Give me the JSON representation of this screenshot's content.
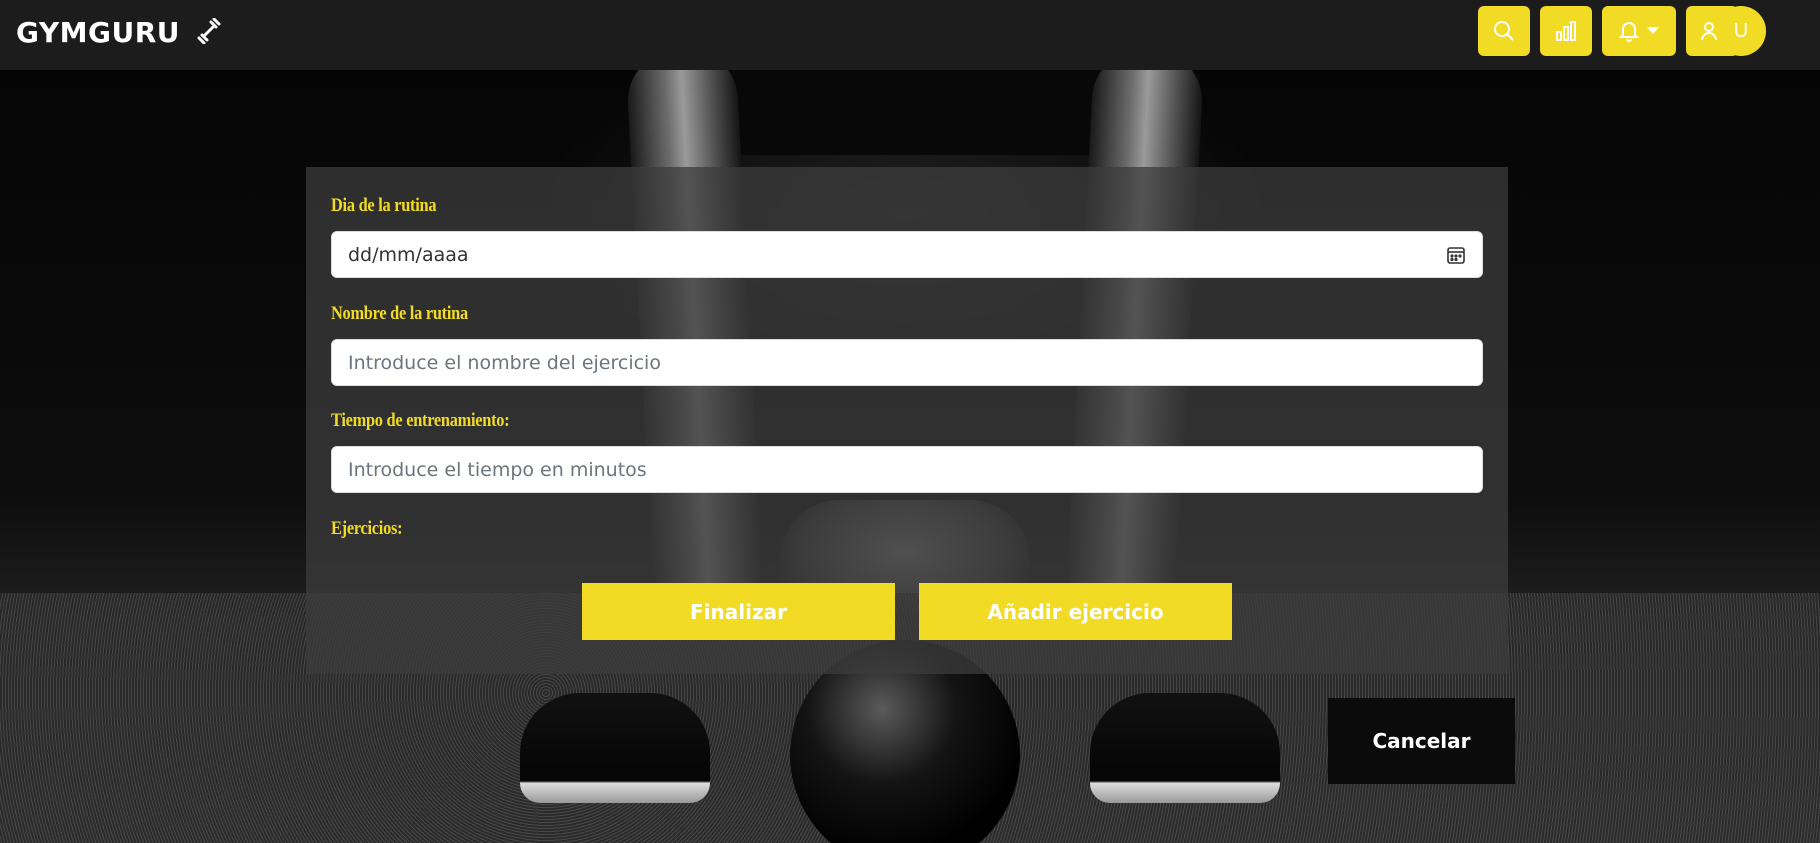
{
  "brand": {
    "name": "GYMGURU",
    "icon": "dumbbell-icon"
  },
  "navbar": {
    "search_icon": "search-icon",
    "stats_icon": "bar-chart-icon",
    "notifications_icon": "bell-icon",
    "add_user_icon": "user-plus-icon",
    "avatar_initial": "U"
  },
  "form": {
    "date": {
      "label": "Dia de la rutina",
      "value": "dd/mm/aaaa"
    },
    "name": {
      "label": "Nombre de la rutina",
      "placeholder": "Introduce el nombre del ejercicio"
    },
    "time": {
      "label": "Tiempo de entrenamiento:",
      "placeholder": "Introduce el tiempo en minutos"
    },
    "exercises_label": "Ejercicios:",
    "finish_label": "Finalizar",
    "add_exercise_label": "Añadir ejercicio"
  },
  "cancel_label": "Cancelar",
  "colors": {
    "accent": "#f2db24",
    "navbar": "#1c1c1c",
    "panel": "#3c3c3c"
  }
}
